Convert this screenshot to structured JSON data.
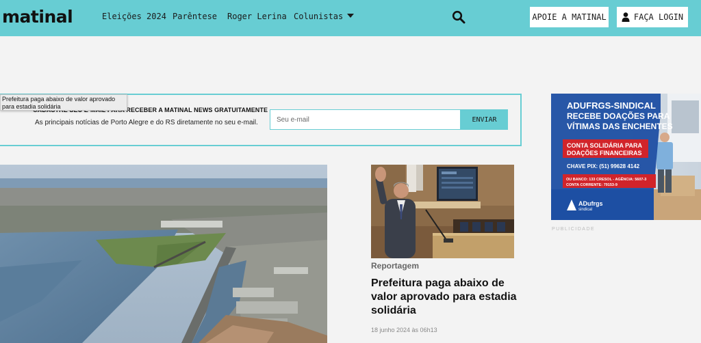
{
  "header": {
    "logo": "matinal",
    "nav": [
      {
        "label": "Eleições 2024"
      },
      {
        "label": "Parêntese"
      },
      {
        "label": "Roger Lerina"
      },
      {
        "label": "Colunistas"
      }
    ],
    "support_label": "APOIE A MATINAL",
    "login_label": "FAÇA LOGIN",
    "icons": [
      "search-icon",
      "user-icon",
      "chevron-down-icon"
    ]
  },
  "newsletter": {
    "title": "CADASTRE SEU E-MAIL PARA RECEBER A MATINAL NEWS GRATUITAMENTE",
    "subtitle": "As principais notícias de Porto Alegre e do RS diretamente no seu e-mail.",
    "email_placeholder": "Seu e-mail",
    "submit_label": "ENVIAR"
  },
  "tooltip": {
    "text": "Prefeitura paga abaixo de valor aprovado para estadia solidária"
  },
  "ad": {
    "headline_1": "ADUFRGS-SINDICAL",
    "headline_2": "RECEBE DOAÇÕES PARA",
    "headline_3": "VÍTIMAS DAS ENCHENTES",
    "box_1": "CONTA SOLIDÁRIA PARA",
    "box_2": "DOAÇÕES FINANCEIRAS",
    "pix": "CHAVE PIX: (51) 99628 4142",
    "bank_1": "OU BANCO: 133 CRESOL - AGÊNCIA: 5607-3",
    "bank_2": "CONTA CORRENTE: 79153-9",
    "brand": "ADufrgs",
    "brand_sub": "sindical",
    "label": "PUBLICIDADE"
  },
  "article": {
    "kicker": "Reportagem",
    "headline": "Prefeitura paga abaixo de valor aprovado para estadia solidária",
    "date": "18 junho 2024 às 06h13"
  },
  "colors": {
    "accent": "#67cdd3",
    "ad_blue": "#1d4fa3",
    "ad_red": "#d1242a"
  }
}
